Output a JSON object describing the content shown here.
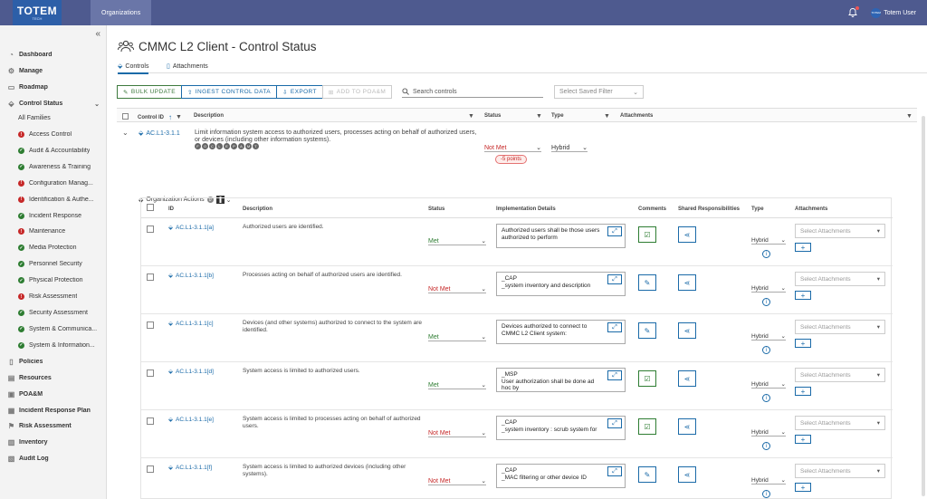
{
  "app": {
    "logo_main": "TOTEM",
    "logo_sub": "TECH",
    "nav_tab": "Organizations",
    "user": "Totem User",
    "avatar_text": "TOTEM"
  },
  "colors": {
    "topbar": "#4e5a8f",
    "met": "#2e7d32",
    "not_met": "#c62828",
    "link": "#1a6aa8"
  },
  "sidebar": {
    "top_items": [
      {
        "label": "Dashboard",
        "icon": "dashboard-icon"
      },
      {
        "label": "Manage",
        "icon": "gear-icon"
      },
      {
        "label": "Roadmap",
        "icon": "roadmap-icon"
      },
      {
        "label": "Control Status",
        "icon": "tag-icon"
      }
    ],
    "all_families": "All Families",
    "families": [
      {
        "label": "Access Control",
        "status": "red"
      },
      {
        "label": "Audit & Accountability",
        "status": "green"
      },
      {
        "label": "Awareness & Training",
        "status": "green"
      },
      {
        "label": "Configuration Manag...",
        "status": "red"
      },
      {
        "label": "Identification & Authe...",
        "status": "red"
      },
      {
        "label": "Incident Response",
        "status": "green"
      },
      {
        "label": "Maintenance",
        "status": "red"
      },
      {
        "label": "Media Protection",
        "status": "green"
      },
      {
        "label": "Personnel Security",
        "status": "green"
      },
      {
        "label": "Physical Protection",
        "status": "green"
      },
      {
        "label": "Risk Assessment",
        "status": "red"
      },
      {
        "label": "Security Assessment",
        "status": "green"
      },
      {
        "label": "System & Communica...",
        "status": "green"
      },
      {
        "label": "System & Information...",
        "status": "green"
      }
    ],
    "bottom_items": [
      {
        "label": "Policies",
        "icon": "policies-icon"
      },
      {
        "label": "Resources",
        "icon": "resources-icon"
      },
      {
        "label": "POA&M",
        "icon": "poam-icon"
      },
      {
        "label": "Incident Response Plan",
        "icon": "incident-plan-icon"
      },
      {
        "label": "Risk Assessment",
        "icon": "risk-icon"
      },
      {
        "label": "Inventory",
        "icon": "inventory-icon"
      },
      {
        "label": "Audit Log",
        "icon": "audit-log-icon"
      }
    ]
  },
  "page": {
    "title": "CMMC L2 Client - Control Status",
    "tab_controls": "Controls",
    "tab_attachments": "Attachments"
  },
  "toolbar": {
    "bulk": "BULK UPDATE",
    "ingest": "INGEST CONTROL DATA",
    "export": "EXPORT",
    "poam": "ADD TO POA&M",
    "search_placeholder": "Search controls",
    "saved_filter": "Select Saved Filter"
  },
  "grid_headers": {
    "control_id": "Control ID",
    "description": "Description",
    "status": "Status",
    "type": "Type",
    "attachments": "Attachments"
  },
  "parent_row": {
    "id": "AC.L1-3.1.1",
    "description": "Limit information system access to authorized users, processes acting on behalf of authorized users, or devices (including other information systems).",
    "status": "Not Met",
    "points": "-5 points",
    "type": "Hybrid",
    "badges": [
      "F",
      "O",
      "C",
      "L",
      "E",
      "P",
      "A",
      "M",
      "T"
    ],
    "org_actions": "Organization Actions",
    "org_actions_count": "0"
  },
  "child_headers": {
    "id": "ID",
    "description": "Description",
    "status": "Status",
    "impl": "Implementation Details",
    "comments": "Comments",
    "shared": "Shared Responsibilities",
    "type": "Type",
    "attachments": "Attachments"
  },
  "child_rows": [
    {
      "id": "AC.L1-3.1.1[a]",
      "desc": "Authorized users are identified.",
      "status": "Met",
      "impl": "Authorized users shall be those users authorized to perform",
      "comment": "done",
      "type": "Hybrid",
      "att": "Select Attachments"
    },
    {
      "id": "AC.L1-3.1.1[b]",
      "desc": "Processes acting on behalf of authorized users are identified.",
      "status": "Not Met",
      "impl": "_CAP\n_system inventory and description",
      "comment": "edit",
      "type": "Hybrid",
      "att": "Select Attachments"
    },
    {
      "id": "AC.L1-3.1.1[c]",
      "desc": "Devices (and other systems) authorized to connect to the system are identified.",
      "status": "Met",
      "impl": "Devices authorized to connect to CMMC L2 Client system:",
      "comment": "edit",
      "type": "Hybrid",
      "att": "Select Attachments"
    },
    {
      "id": "AC.L1-3.1.1[d]",
      "desc": "System access is limited to authorized users.",
      "status": "Met",
      "impl": "_MSP\nUser authorization shall be done ad hoc by",
      "comment": "done",
      "type": "Hybrid",
      "att": "Select Attachments"
    },
    {
      "id": "AC.L1-3.1.1[e]",
      "desc": "System access is limited to processes acting on behalf of authorized users.",
      "status": "Not Met",
      "impl": "_CAP\n_system inventory : scrub system for",
      "comment": "done",
      "type": "Hybrid",
      "att": "Select Attachments"
    },
    {
      "id": "AC.L1-3.1.1[f]",
      "desc": "System access is limited to authorized devices (including other systems).",
      "status": "Not Met",
      "impl": "_CAP\n_MAC filtering or other device ID",
      "comment": "edit",
      "type": "Hybrid",
      "att": "Select Attachments"
    }
  ]
}
